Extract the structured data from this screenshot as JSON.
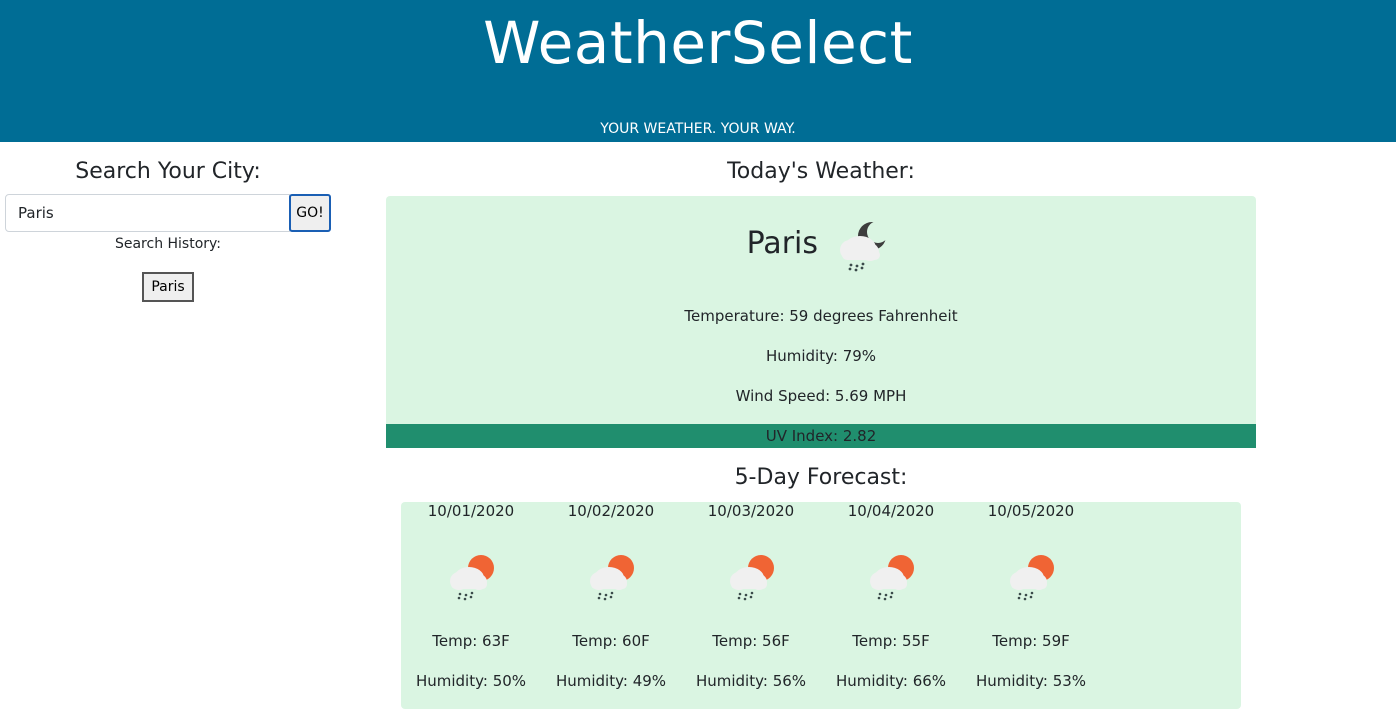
{
  "header": {
    "title": "WeatherSelect",
    "tagline": "YOUR WEATHER. YOUR WAY.",
    "background": "#006d95"
  },
  "search": {
    "heading": "Search Your City:",
    "value": "Paris",
    "go_label": "GO!",
    "history_label": "Search History:",
    "history": [
      "Paris"
    ]
  },
  "today": {
    "heading": "Today's Weather:",
    "city": "Paris",
    "icon": "rain-night-cloud-icon",
    "temperature": "Temperature: 59 degrees Fahrenheit",
    "humidity": "Humidity: 79%",
    "wind": "Wind Speed: 5.69 MPH",
    "uv": "UV Index: 2.82",
    "uv_color": "#208e6e",
    "card_color": "#daf5e2"
  },
  "forecast": {
    "heading": "5-Day Forecast:",
    "days": [
      {
        "date": "10/01/2020",
        "icon": "rain-sun-cloud-icon",
        "temp": "Temp: 63F",
        "humidity": "Humidity: 50%"
      },
      {
        "date": "10/02/2020",
        "icon": "rain-sun-cloud-icon",
        "temp": "Temp: 60F",
        "humidity": "Humidity: 49%"
      },
      {
        "date": "10/03/2020",
        "icon": "rain-sun-cloud-icon",
        "temp": "Temp: 56F",
        "humidity": "Humidity: 56%"
      },
      {
        "date": "10/04/2020",
        "icon": "rain-sun-cloud-icon",
        "temp": "Temp: 55F",
        "humidity": "Humidity: 66%"
      },
      {
        "date": "10/05/2020",
        "icon": "rain-sun-cloud-icon",
        "temp": "Temp: 59F",
        "humidity": "Humidity: 53%"
      }
    ]
  }
}
